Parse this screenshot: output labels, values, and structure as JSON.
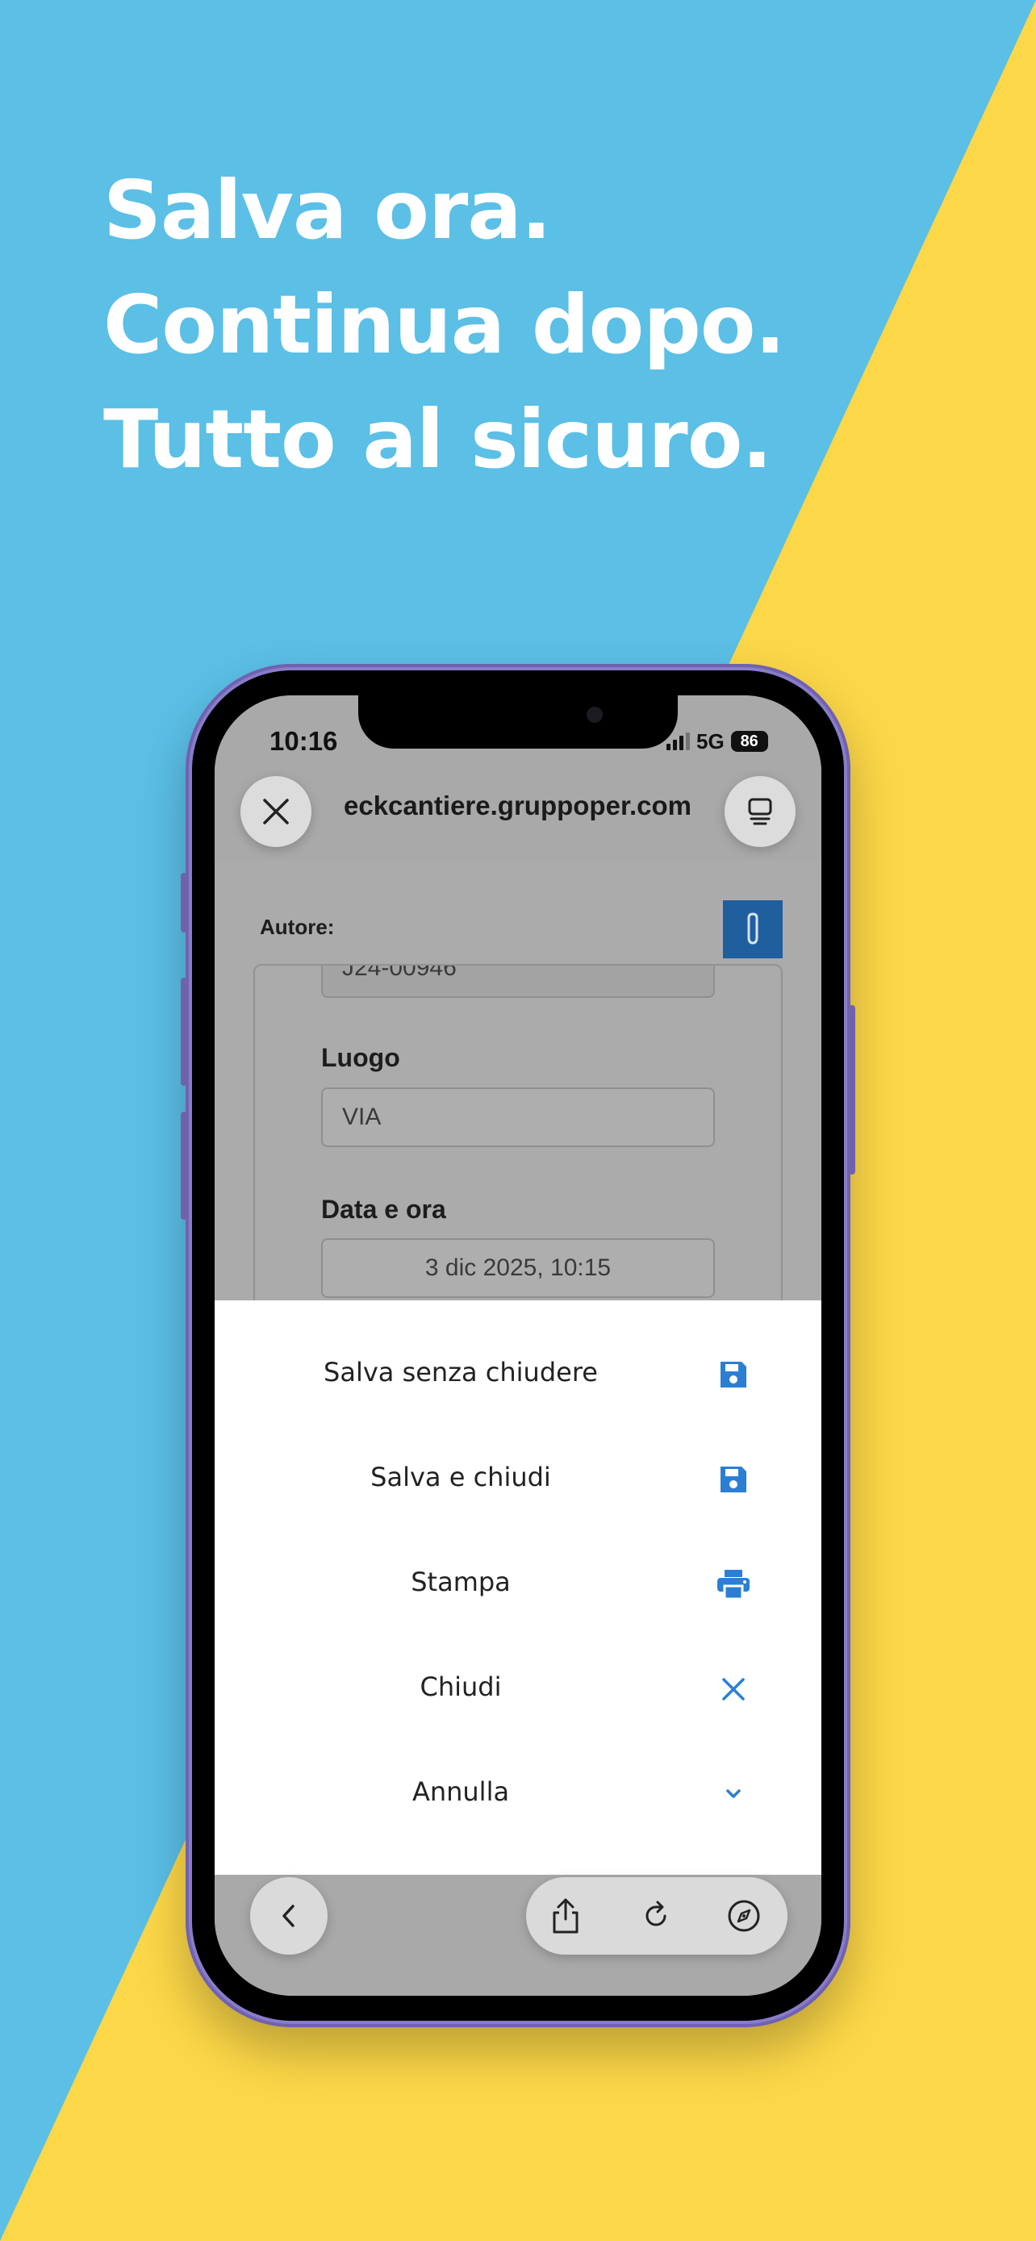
{
  "headline": [
    "Salva ora.",
    "Continua dopo.",
    "Tutto al sicuro."
  ],
  "colors": {
    "blue": "#5bbfe6",
    "yellow": "#fcd748",
    "accent": "#2a7fd4",
    "frame": "#8a7cc9"
  },
  "status": {
    "time": "10:16",
    "network": "5G",
    "battery": "86"
  },
  "browser": {
    "url": "eckcantiere.gruppoper.com",
    "close_icon": "close-icon",
    "tabs_icon": "tab-overview-icon"
  },
  "page": {
    "author_label": "Autore:",
    "code_value": "J24-00946",
    "place_label": "Luogo",
    "place_value": "VIA",
    "date_label": "Data e ora",
    "date_value": "3 dic 2025, 10:15"
  },
  "sheet": {
    "items": [
      {
        "label": "Salva senza chiudere",
        "icon": "floppy-disk-icon"
      },
      {
        "label": "Salva e chiudi",
        "icon": "floppy-disk-icon"
      },
      {
        "label": "Stampa",
        "icon": "printer-icon"
      },
      {
        "label": "Chiudi",
        "icon": "close-icon"
      },
      {
        "label": "Annulla",
        "icon": "chevron-down-icon"
      }
    ]
  },
  "toolbar": {
    "back_icon": "chevron-left-icon",
    "share_icon": "share-icon",
    "reload_icon": "reload-icon",
    "compass_icon": "compass-icon"
  }
}
